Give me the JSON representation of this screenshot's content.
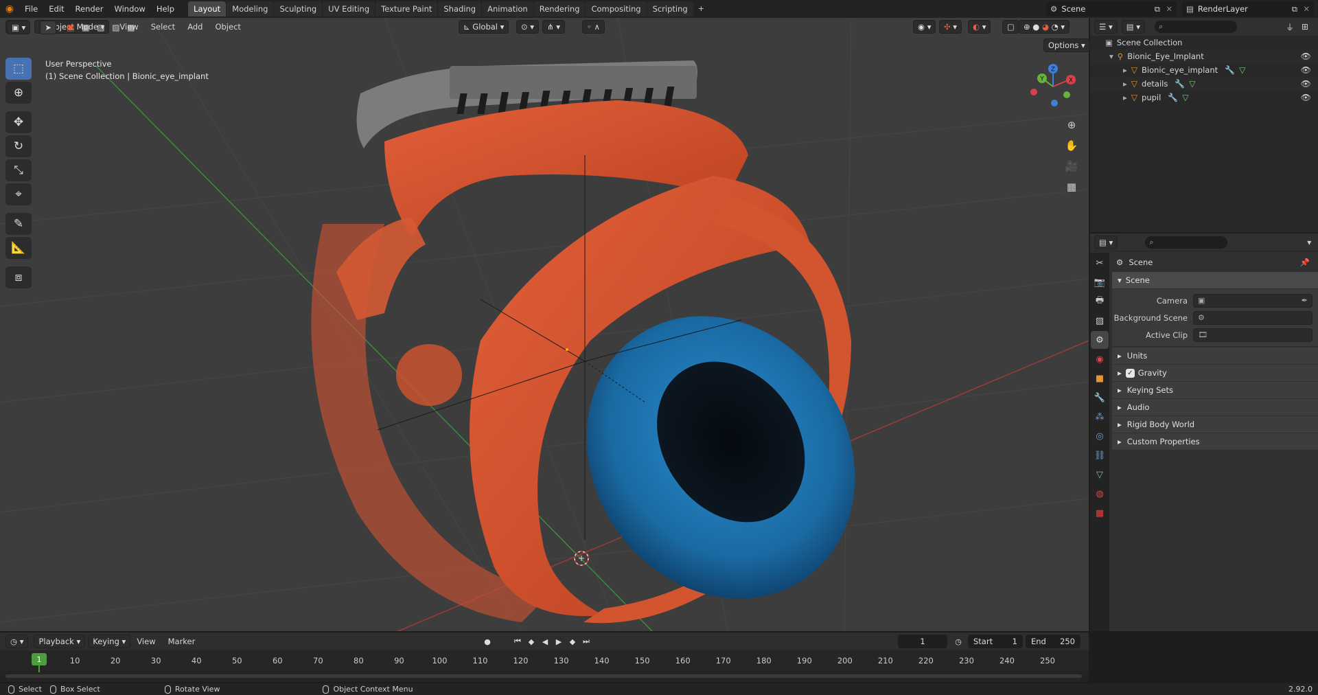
{
  "menubar": {
    "items": [
      "File",
      "Edit",
      "Render",
      "Window",
      "Help"
    ],
    "workspaces": [
      "Layout",
      "Modeling",
      "Sculpting",
      "UV Editing",
      "Texture Paint",
      "Shading",
      "Animation",
      "Rendering",
      "Compositing",
      "Scripting"
    ],
    "active_workspace": "Layout",
    "add_tab": "+",
    "scene_name": "Scene",
    "view_layer": "RenderLayer"
  },
  "viewport": {
    "mode": "Object Mode",
    "menus": [
      "View",
      "Select",
      "Add",
      "Object"
    ],
    "transform_orientation": "Global",
    "options_label": "Options",
    "overlay_line1": "User Perspective",
    "overlay_line2": "(1) Scene Collection | Bionic_eye_implant",
    "gizmo_axes": {
      "x": "X",
      "y": "Y",
      "z": "Z"
    },
    "colors": {
      "background": "#3d3d3d",
      "grid": "#464646",
      "x_axis": "#9e3a3a",
      "y_axis": "#3e8a3e",
      "iris": "#1d76b4",
      "circuit": "#d9522e"
    }
  },
  "toolbar": {
    "tools": [
      "select-box",
      "cursor",
      "move",
      "rotate",
      "scale",
      "transform",
      "annotate",
      "measure",
      "add-cube"
    ],
    "active_tool": "select-box"
  },
  "outliner": {
    "root": "Scene Collection",
    "collection": "Bionic_Eye_Implant",
    "objects": [
      "Bionic_eye_implant",
      "details",
      "pupil"
    ]
  },
  "properties": {
    "title": "Scene",
    "panel": "Scene",
    "fields": [
      {
        "label": "Camera",
        "value": ""
      },
      {
        "label": "Background Scene",
        "value": ""
      },
      {
        "label": "Active Clip",
        "value": ""
      }
    ],
    "subpanels": [
      "Units",
      "Gravity",
      "Keying Sets",
      "Audio",
      "Rigid Body World",
      "Custom Properties"
    ],
    "gravity_checked": true
  },
  "timeline": {
    "menus": [
      "Playback",
      "Keying",
      "View",
      "Marker"
    ],
    "current_frame": "1",
    "start_label": "Start",
    "start": "1",
    "end_label": "End",
    "end": "250",
    "cursor_frame": "1",
    "ticks": [
      "10",
      "20",
      "30",
      "40",
      "50",
      "60",
      "70",
      "80",
      "90",
      "100",
      "110",
      "120",
      "130",
      "140",
      "150",
      "160",
      "170",
      "180",
      "190",
      "200",
      "210",
      "220",
      "230",
      "240",
      "250"
    ]
  },
  "statusbar": {
    "select": "Select",
    "box_select": "Box Select",
    "rotate_view": "Rotate View",
    "context_menu": "Object Context Menu",
    "version": "2.92.0"
  }
}
